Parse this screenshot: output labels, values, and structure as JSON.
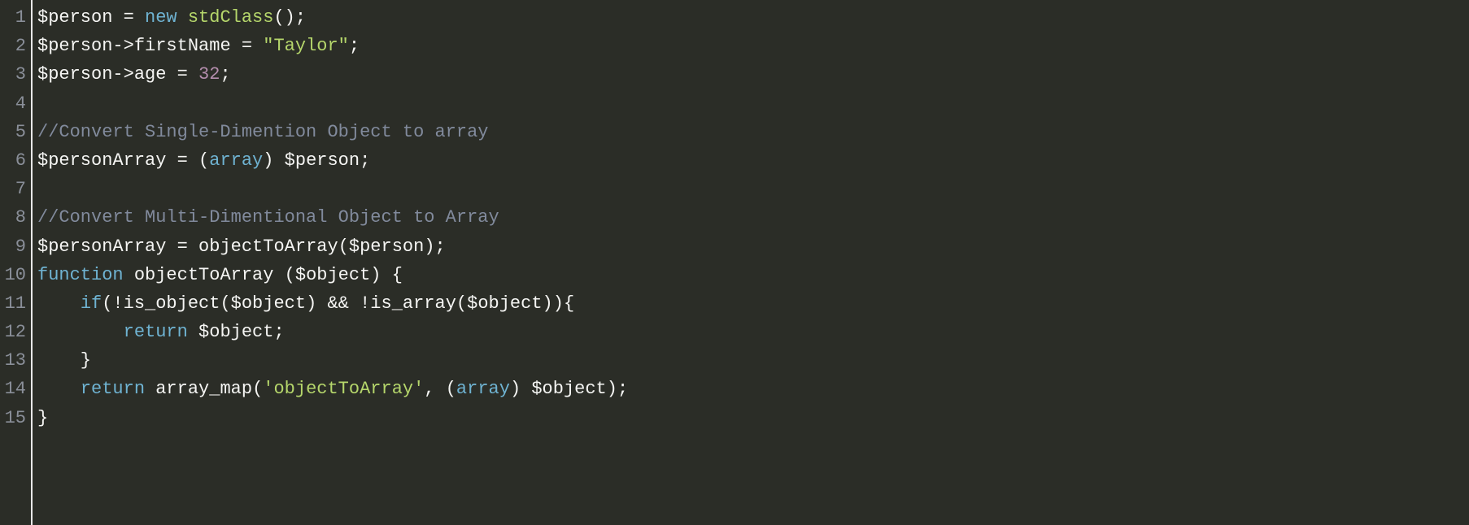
{
  "code": {
    "lines": [
      {
        "n": "1",
        "tokens": [
          {
            "t": "$person",
            "c": "tok-var"
          },
          {
            "t": " = ",
            "c": "tok-op"
          },
          {
            "t": "new",
            "c": "tok-kw"
          },
          {
            "t": " ",
            "c": ""
          },
          {
            "t": "stdClass",
            "c": "tok-class"
          },
          {
            "t": "();",
            "c": "tok-punc"
          }
        ]
      },
      {
        "n": "2",
        "tokens": [
          {
            "t": "$person",
            "c": "tok-var"
          },
          {
            "t": "->",
            "c": "tok-op"
          },
          {
            "t": "firstName",
            "c": "tok-var"
          },
          {
            "t": " = ",
            "c": "tok-op"
          },
          {
            "t": "\"Taylor\"",
            "c": "tok-str"
          },
          {
            "t": ";",
            "c": "tok-punc"
          }
        ]
      },
      {
        "n": "3",
        "tokens": [
          {
            "t": "$person",
            "c": "tok-var"
          },
          {
            "t": "->",
            "c": "tok-op"
          },
          {
            "t": "age",
            "c": "tok-var"
          },
          {
            "t": " = ",
            "c": "tok-op"
          },
          {
            "t": "32",
            "c": "tok-num"
          },
          {
            "t": ";",
            "c": "tok-punc"
          }
        ]
      },
      {
        "n": "4",
        "tokens": []
      },
      {
        "n": "5",
        "tokens": [
          {
            "t": "//Convert Single-Dimention Object to array",
            "c": "tok-comm"
          }
        ]
      },
      {
        "n": "6",
        "tokens": [
          {
            "t": "$personArray",
            "c": "tok-var"
          },
          {
            "t": " = (",
            "c": "tok-op"
          },
          {
            "t": "array",
            "c": "tok-kw"
          },
          {
            "t": ") ",
            "c": "tok-op"
          },
          {
            "t": "$person",
            "c": "tok-var"
          },
          {
            "t": ";",
            "c": "tok-punc"
          }
        ]
      },
      {
        "n": "7",
        "tokens": []
      },
      {
        "n": "8",
        "tokens": [
          {
            "t": "//Convert Multi-Dimentional Object to Array",
            "c": "tok-comm"
          }
        ]
      },
      {
        "n": "9",
        "tokens": [
          {
            "t": "$personArray",
            "c": "tok-var"
          },
          {
            "t": " = ",
            "c": "tok-op"
          },
          {
            "t": "objectToArray",
            "c": "tok-func"
          },
          {
            "t": "(",
            "c": "tok-punc"
          },
          {
            "t": "$person",
            "c": "tok-var"
          },
          {
            "t": ");",
            "c": "tok-punc"
          }
        ]
      },
      {
        "n": "10",
        "tokens": [
          {
            "t": "function",
            "c": "tok-kw"
          },
          {
            "t": " ",
            "c": ""
          },
          {
            "t": "objectToArray",
            "c": "tok-func"
          },
          {
            "t": " (",
            "c": "tok-punc"
          },
          {
            "t": "$object",
            "c": "tok-var"
          },
          {
            "t": ") {",
            "c": "tok-punc"
          }
        ]
      },
      {
        "n": "11",
        "tokens": [
          {
            "t": "    ",
            "c": ""
          },
          {
            "t": "if",
            "c": "tok-kw"
          },
          {
            "t": "(!",
            "c": "tok-op"
          },
          {
            "t": "is_object",
            "c": "tok-func"
          },
          {
            "t": "(",
            "c": "tok-punc"
          },
          {
            "t": "$object",
            "c": "tok-var"
          },
          {
            "t": ") && !",
            "c": "tok-op"
          },
          {
            "t": "is_array",
            "c": "tok-func"
          },
          {
            "t": "(",
            "c": "tok-punc"
          },
          {
            "t": "$object",
            "c": "tok-var"
          },
          {
            "t": ")){",
            "c": "tok-punc"
          }
        ]
      },
      {
        "n": "12",
        "tokens": [
          {
            "t": "        ",
            "c": ""
          },
          {
            "t": "return",
            "c": "tok-kw"
          },
          {
            "t": " ",
            "c": ""
          },
          {
            "t": "$object",
            "c": "tok-var"
          },
          {
            "t": ";",
            "c": "tok-punc"
          }
        ]
      },
      {
        "n": "13",
        "tokens": [
          {
            "t": "    }",
            "c": "tok-punc"
          }
        ]
      },
      {
        "n": "14",
        "tokens": [
          {
            "t": "    ",
            "c": ""
          },
          {
            "t": "return",
            "c": "tok-kw"
          },
          {
            "t": " ",
            "c": ""
          },
          {
            "t": "array_map",
            "c": "tok-func"
          },
          {
            "t": "(",
            "c": "tok-punc"
          },
          {
            "t": "'objectToArray'",
            "c": "tok-str"
          },
          {
            "t": ", (",
            "c": "tok-op"
          },
          {
            "t": "array",
            "c": "tok-kw"
          },
          {
            "t": ") ",
            "c": "tok-op"
          },
          {
            "t": "$object",
            "c": "tok-var"
          },
          {
            "t": ");",
            "c": "tok-punc"
          }
        ]
      },
      {
        "n": "15",
        "tokens": [
          {
            "t": "}",
            "c": "tok-punc"
          }
        ]
      }
    ]
  }
}
